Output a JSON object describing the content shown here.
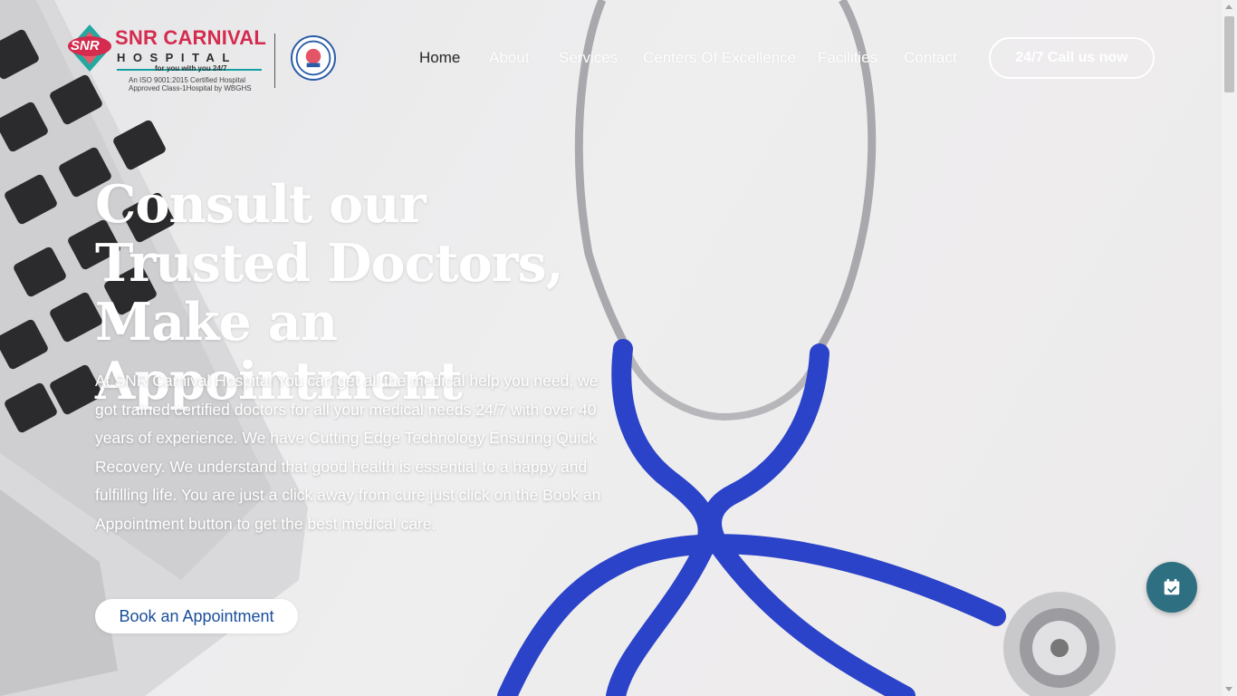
{
  "header": {
    "logo": {
      "initials": "SNR",
      "name": "SNR CARNIVAL",
      "subtitle": "HOSPITAL",
      "tagline": "for you with you 24/7",
      "cert_line1": "An ISO 9001:2015 Certified Hospital",
      "cert_line2": "Approved Class-1Hospital by WBGHS"
    },
    "nav": [
      {
        "label": "Home",
        "active": true
      },
      {
        "label": "About",
        "active": false
      },
      {
        "label": "Services",
        "active": false
      },
      {
        "label": "Centers Of Excellence",
        "active": false
      },
      {
        "label": "Facilities",
        "active": false
      },
      {
        "label": "Contact",
        "active": false
      }
    ],
    "call_button": "24/7 Call us now"
  },
  "hero": {
    "title": "Consult our Trusted Doctors, Make an Appointment",
    "description": "At SNR Carnival Hospital You can get all the medical help you need, we got trained certified doctors for all your medical needs 24/7 with over 40 years of experience. We have Cutting Edge Technology Ensuring Quick Recovery. We understand that good health is essential to a happy and fulfilling life. You are just a click away from cure just click on the Book an Appointment button to get the best medical care.",
    "cta_button": "Book an Appointment"
  },
  "floating_button": {
    "icon": "calendar-check-icon"
  },
  "colors": {
    "brand_red": "#d42b4e",
    "brand_teal": "#12a0a0",
    "cta_text": "#1b4e9b",
    "fab_bg": "#2e7082",
    "stethoscope_blue": "#2b43c8"
  }
}
